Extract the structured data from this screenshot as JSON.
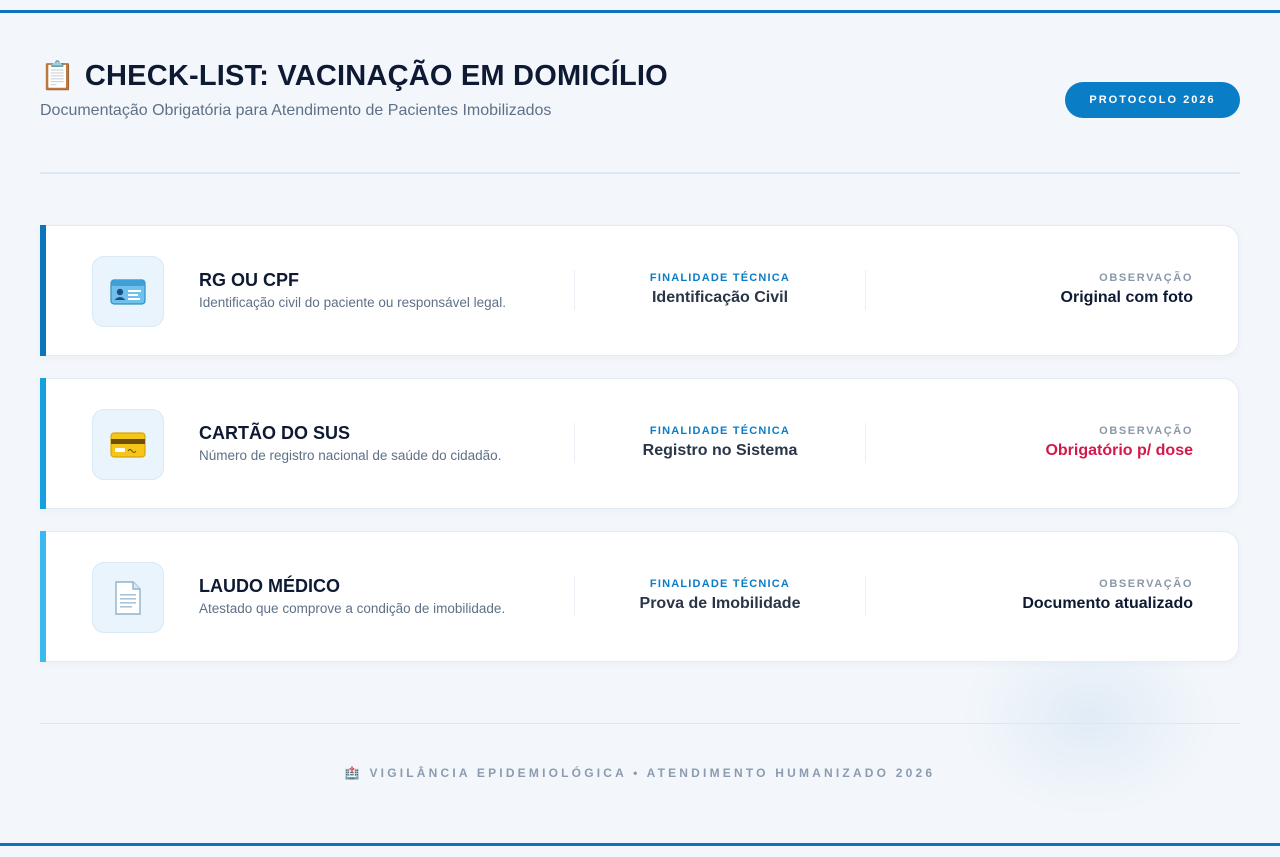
{
  "header": {
    "title_icon": "📋",
    "title": "CHECK-LIST: VACINAÇÃO EM DOMICÍLIO",
    "subtitle": "Documentação Obrigatória para Atendimento de Pacientes Imobilizados",
    "badge": "PROTOCOLO 2026"
  },
  "items": [
    {
      "icon": "🪪",
      "icon_name": "id-card-icon",
      "accent": "#0a75bd",
      "name": "RG OU CPF",
      "description": "Identificação civil do paciente ou responsável legal.",
      "purpose_label": "FINALIDADE TÉCNICA",
      "purpose": "Identificação Civil",
      "note_label": "OBSERVAÇÃO",
      "note": "Original com foto",
      "note_alert": false
    },
    {
      "icon": "💳",
      "icon_name": "credit-card-icon",
      "accent": "#16a0e0",
      "name": "CARTÃO DO SUS",
      "description": "Número de registro nacional de saúde do cidadão.",
      "purpose_label": "FINALIDADE TÉCNICA",
      "purpose": "Registro no Sistema",
      "note_label": "OBSERVAÇÃO",
      "note": "Obrigatório p/ dose",
      "note_alert": true
    },
    {
      "icon": "📄",
      "icon_name": "document-icon",
      "accent": "#3bb8ee",
      "name": "LAUDO MÉDICO",
      "description": "Atestado que comprove a condição de imobilidade.",
      "purpose_label": "FINALIDADE TÉCNICA",
      "purpose": "Prova de Imobilidade",
      "note_label": "OBSERVAÇÃO",
      "note": "Documento atualizado",
      "note_alert": false
    }
  ],
  "footer": {
    "icon": "🏥",
    "text": "VIGILÂNCIA EPIDEMIOLÓGICA • ATENDIMENTO HUMANIZADO 2026"
  },
  "colors": {
    "brand": "#0a7dc7",
    "alert": "#d4184a"
  }
}
